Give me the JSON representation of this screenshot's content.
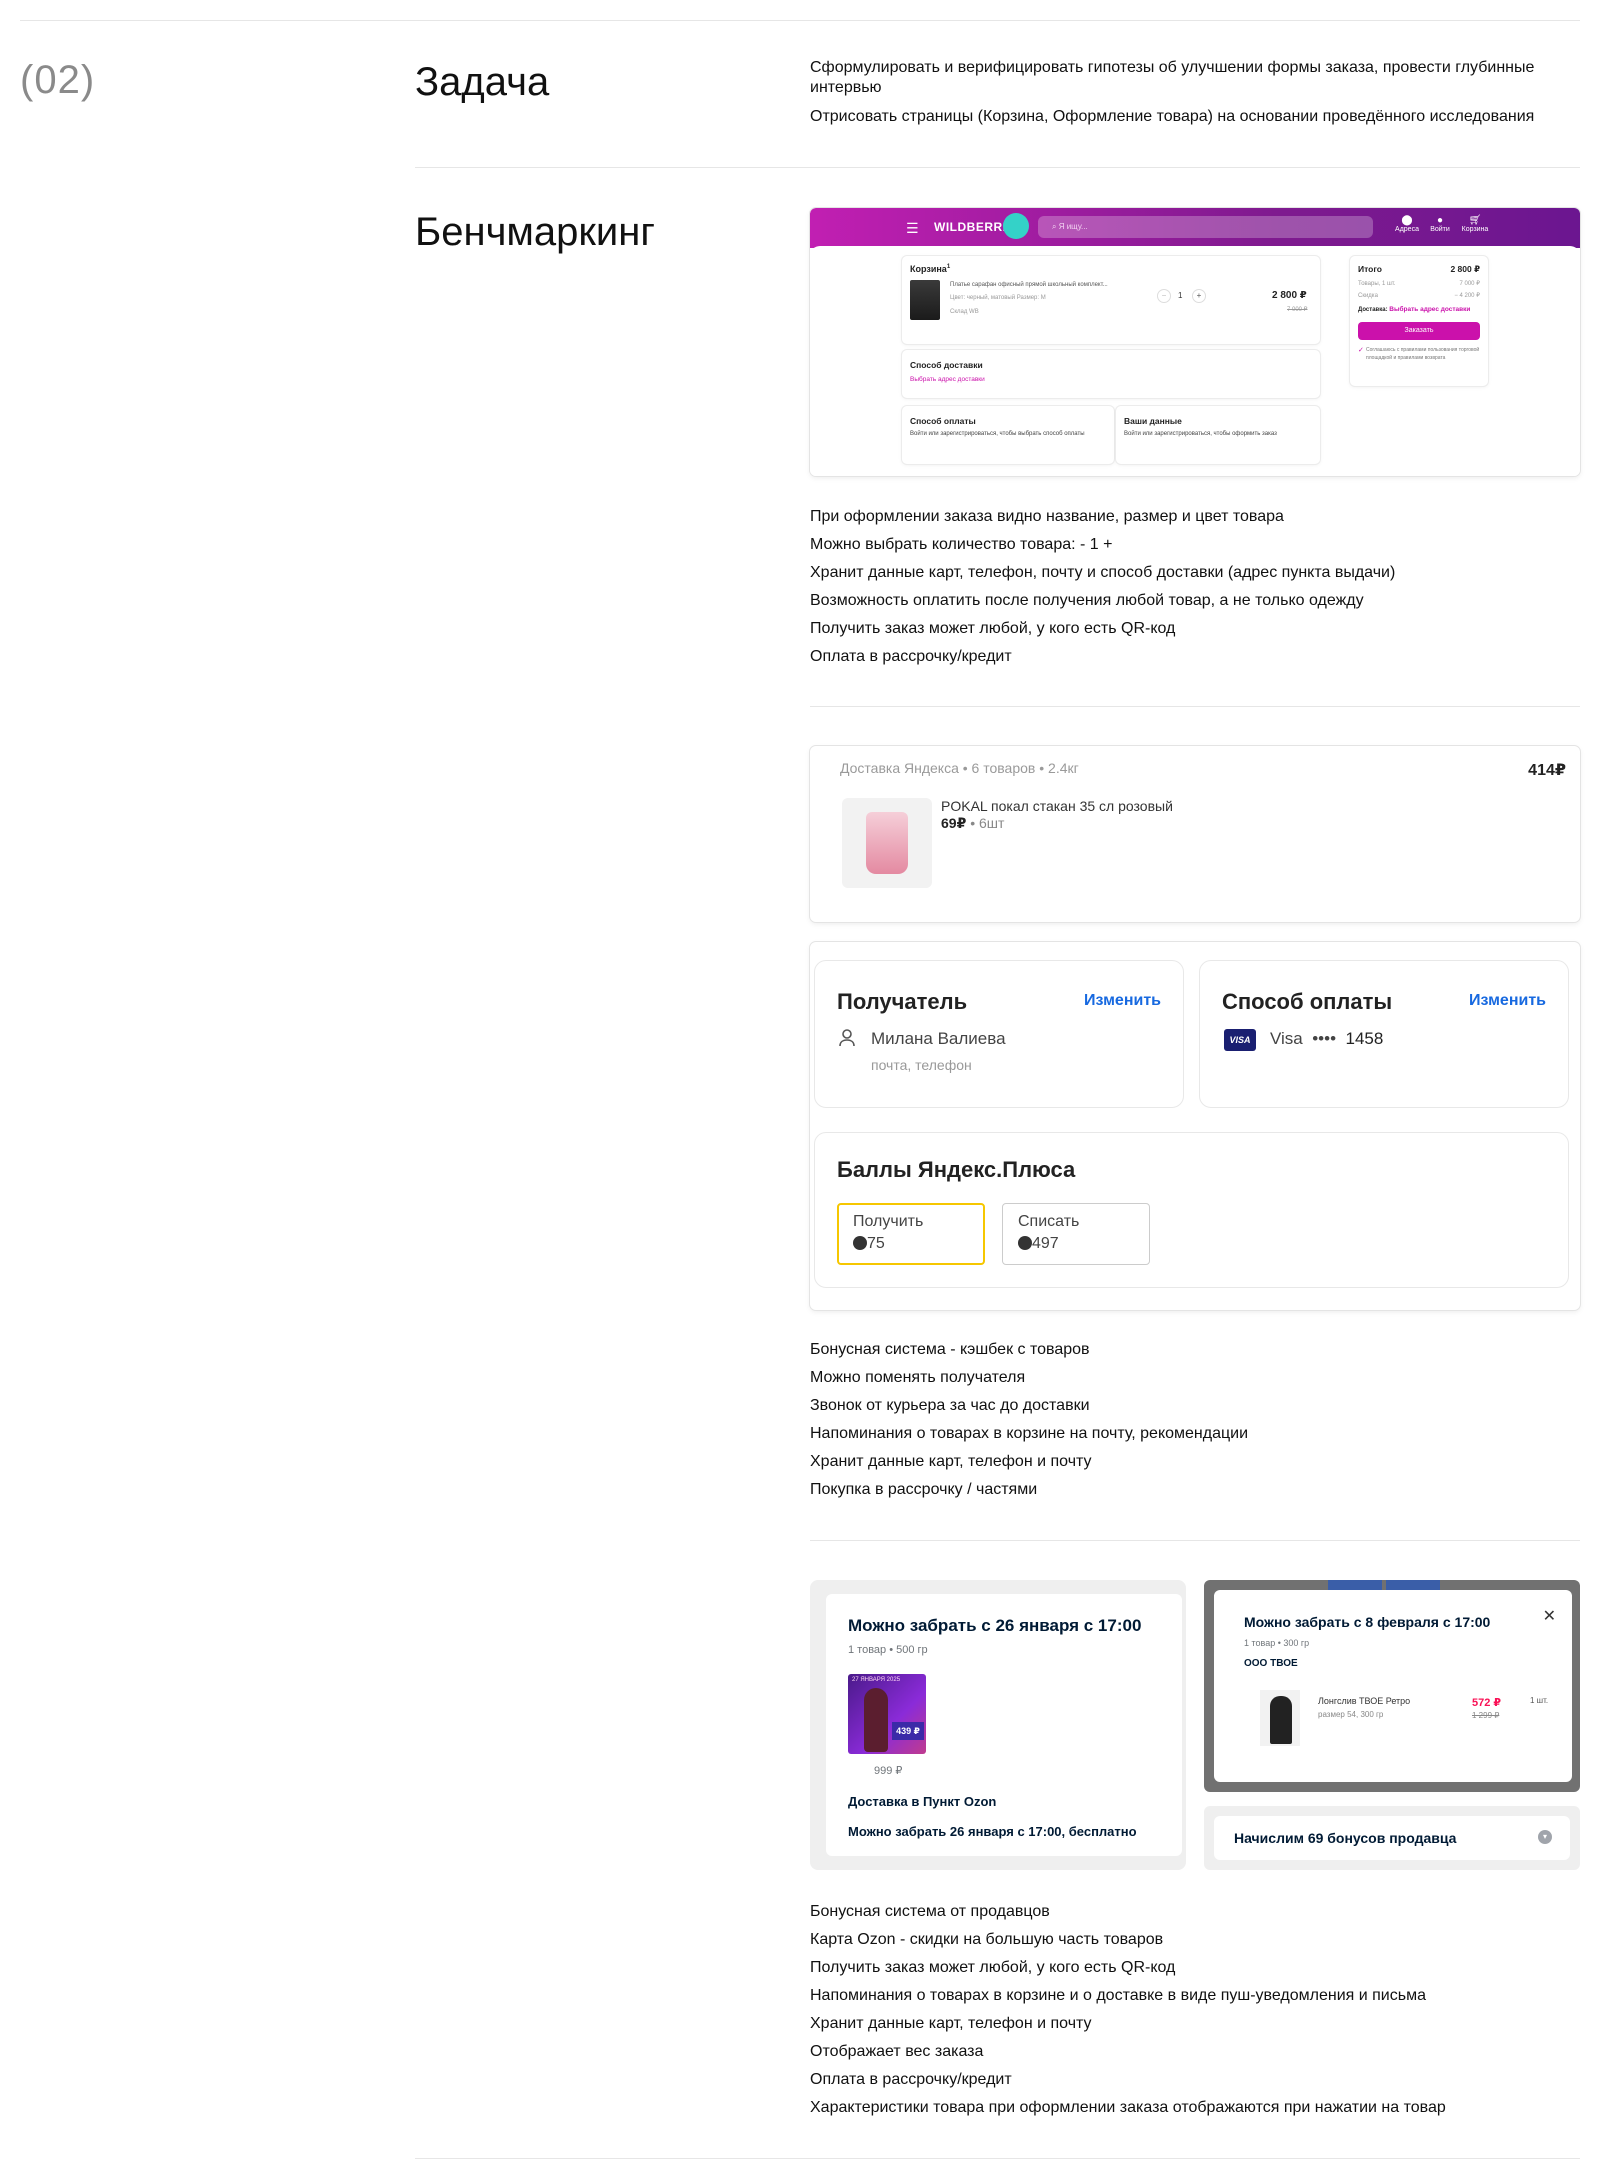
{
  "section": {
    "number": "(02)",
    "task_title": "Задача",
    "task_lines": [
      "Сформулировать и верифицировать гипотезы об улучшении формы заказа, провести глубинные интервью",
      "Отрисовать страницы (Корзина, Оформление товара) на основании проведённого исследования"
    ],
    "benchmark_title": "Бенчмаркинг"
  },
  "wildberries": {
    "logo": "WILDBERRIES",
    "search_placeholder": "Я ищу...",
    "nav": [
      "Адреса",
      "Войти",
      "Корзина"
    ],
    "cart_title": "Корзина",
    "cart_count": "1",
    "item_name": "Платье сарафан офисный прямой школьный комплект...",
    "item_meta": "Цвет: черный, матовый    Размер: M",
    "item_warehouse": "Склад WB",
    "qty": "1",
    "minus": "−",
    "plus": "+",
    "price": "2 800 ₽",
    "old_price": "7 000 ₽",
    "delivery_title": "Способ доставки",
    "delivery_link": "Выбрать адрес доставки",
    "payment_title": "Способ оплаты",
    "payment_text": "Войти или зарегистрироваться, чтобы выбрать способ оплаты",
    "yourdata_title": "Ваши данные",
    "yourdata_text": "Войти или зарегистрироваться, чтобы оформить заказ",
    "total_label": "Итого",
    "total_value": "2 800 ₽",
    "goods_label": "Товары, 1 шт.",
    "goods_value": "7 000 ₽",
    "discount_label": "Скидка",
    "discount_value": "− 4 200 ₽",
    "delivery_label": "Доставка:",
    "delivery_value": "Выбрать адрес доставки",
    "order_button": "Заказать",
    "agree_text": "Соглашаюсь с правилами пользования торговой площадкой и правилами возврата"
  },
  "wb_notes": [
    "При оформлении заказа видно название, размер и цвет товара",
    "Можно выбрать количество товара: - 1 +",
    "Хранит данные карт, телефон, почту и способ доставки (адрес пункта выдачи)",
    "Возможность оплатить после получения любой товар, а не только одежду",
    "Получить заказ может любой, у кого есть QR-код",
    "Оплата в рассрочку/кредит"
  ],
  "yandex": {
    "delivery_line": "Доставка Яндекса • 6 товаров • 2.4кг",
    "total": "414₽",
    "item_name": "POKAL покал стакан 35 сл розовый",
    "item_price": "69₽",
    "item_qty": "• 6шт",
    "recipient_title": "Получатель",
    "recipient_edit": "Изменить",
    "recipient_name": "Милана Валиева",
    "recipient_hint": "почта, телефон",
    "payment_title": "Способ оплаты",
    "payment_edit": "Изменить",
    "card_brand": "VISA",
    "card_name": "Visa",
    "card_dots": "••••",
    "card_last": "1458",
    "plus_title": "Баллы Яндекс.Плюса",
    "get_label": "Получить",
    "get_value": "75",
    "spend_label": "Списать",
    "spend_value": "497"
  },
  "yandex_notes": [
    "Бонусная система - кэшбек с товаров",
    "Можно поменять получателя",
    "Звонок от курьера за час до доставки",
    "Напоминания о товарах в корзине на почту, рекомендации",
    "Хранит данные карт, телефон и почту",
    "Покупка в рассрочку / частями"
  ],
  "ozon": {
    "left_title": "Можно забрать с 26 января с 17:00",
    "left_sub": "1 товар • 500 гр",
    "promo_date": "27 ЯНВАРЯ 2025",
    "promo_price": "439 ₽",
    "left_price": "999 ₽",
    "left_delivery": "Доставка в Пункт Ozon",
    "left_pickup": "Можно забрать 26 января с 17:00, бесплатно",
    "right_title": "Можно забрать с 8 февраля с 17:00",
    "right_sub": "1 товар • 300 гр",
    "right_seller": "ООО ТВОЕ",
    "right_item": "Лонгслив ТВОЕ Ретро",
    "right_item_meta": "размер 54, 300 гр",
    "right_price": "572 ₽",
    "right_old_price": "1 299 ₽",
    "right_qty": "1 шт.",
    "bonus_text": "Начислим 69 бонусов продавца"
  },
  "ozon_notes": [
    "Бонусная система от продавцов",
    "Карта Ozon - скидки на большую часть товаров",
    "Получить заказ может любой, у кого есть QR-код",
    "Напоминания о товарах в корзине и о доставке в виде пуш-уведомления и письма",
    "Хранит данные карт, телефон и почту",
    "Отображает вес заказа",
    "Оплата в рассрочку/кредит",
    "Характеристики товара при оформлении заказа отображаются при нажатии на товар"
  ]
}
